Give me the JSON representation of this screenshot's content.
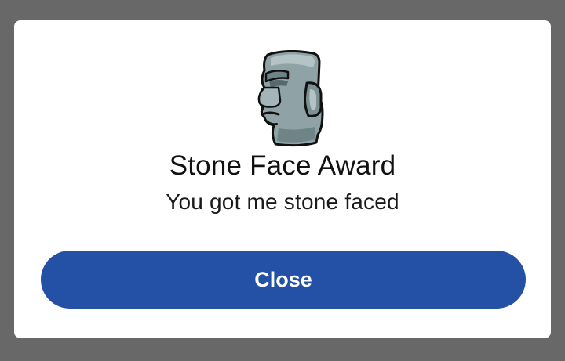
{
  "dialog": {
    "icon": "moai-stone-face-icon",
    "title": "Stone Face Award",
    "description": "You got me stone faced",
    "close_label": "Close"
  },
  "colors": {
    "backdrop": "#686868",
    "dialog_background": "#ffffff",
    "button_background": "#2451a6",
    "button_text": "#ffffff",
    "title_text": "#111111"
  }
}
